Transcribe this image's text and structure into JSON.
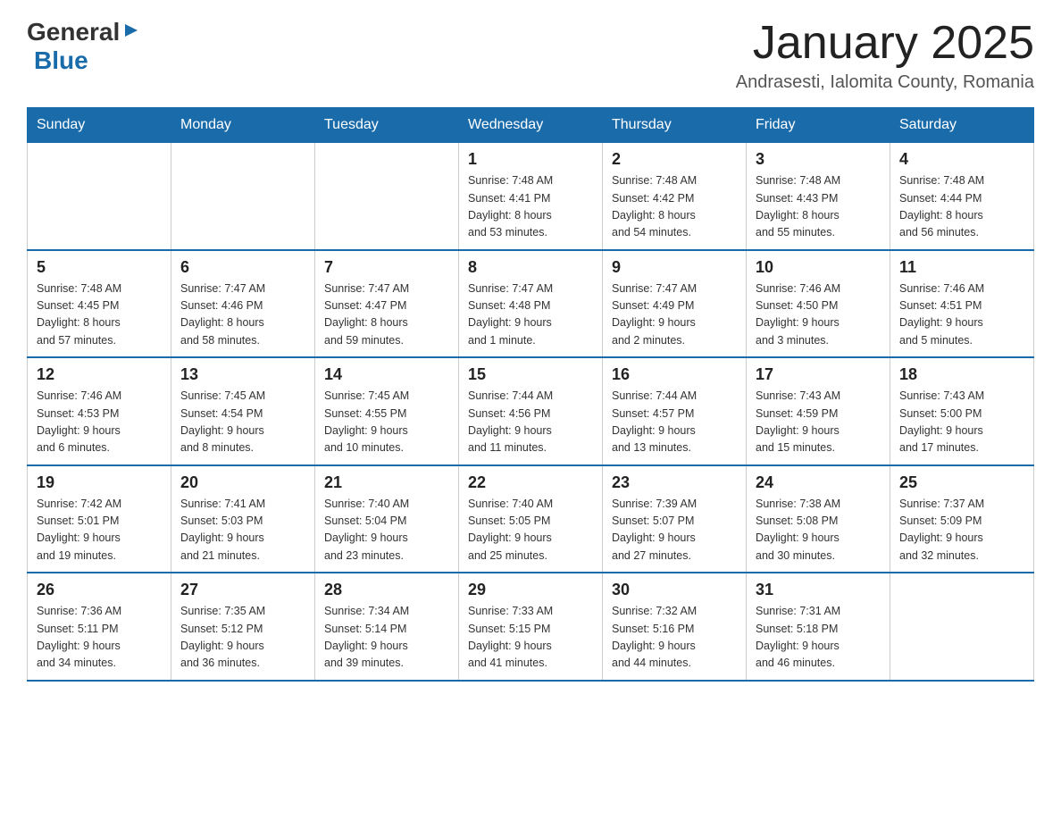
{
  "header": {
    "logo": {
      "general": "General",
      "blue": "Blue"
    },
    "title": "January 2025",
    "subtitle": "Andrasesti, Ialomita County, Romania"
  },
  "weekdays": [
    "Sunday",
    "Monday",
    "Tuesday",
    "Wednesday",
    "Thursday",
    "Friday",
    "Saturday"
  ],
  "weeks": [
    [
      {
        "day": "",
        "info": ""
      },
      {
        "day": "",
        "info": ""
      },
      {
        "day": "",
        "info": ""
      },
      {
        "day": "1",
        "info": "Sunrise: 7:48 AM\nSunset: 4:41 PM\nDaylight: 8 hours\nand 53 minutes."
      },
      {
        "day": "2",
        "info": "Sunrise: 7:48 AM\nSunset: 4:42 PM\nDaylight: 8 hours\nand 54 minutes."
      },
      {
        "day": "3",
        "info": "Sunrise: 7:48 AM\nSunset: 4:43 PM\nDaylight: 8 hours\nand 55 minutes."
      },
      {
        "day": "4",
        "info": "Sunrise: 7:48 AM\nSunset: 4:44 PM\nDaylight: 8 hours\nand 56 minutes."
      }
    ],
    [
      {
        "day": "5",
        "info": "Sunrise: 7:48 AM\nSunset: 4:45 PM\nDaylight: 8 hours\nand 57 minutes."
      },
      {
        "day": "6",
        "info": "Sunrise: 7:47 AM\nSunset: 4:46 PM\nDaylight: 8 hours\nand 58 minutes."
      },
      {
        "day": "7",
        "info": "Sunrise: 7:47 AM\nSunset: 4:47 PM\nDaylight: 8 hours\nand 59 minutes."
      },
      {
        "day": "8",
        "info": "Sunrise: 7:47 AM\nSunset: 4:48 PM\nDaylight: 9 hours\nand 1 minute."
      },
      {
        "day": "9",
        "info": "Sunrise: 7:47 AM\nSunset: 4:49 PM\nDaylight: 9 hours\nand 2 minutes."
      },
      {
        "day": "10",
        "info": "Sunrise: 7:46 AM\nSunset: 4:50 PM\nDaylight: 9 hours\nand 3 minutes."
      },
      {
        "day": "11",
        "info": "Sunrise: 7:46 AM\nSunset: 4:51 PM\nDaylight: 9 hours\nand 5 minutes."
      }
    ],
    [
      {
        "day": "12",
        "info": "Sunrise: 7:46 AM\nSunset: 4:53 PM\nDaylight: 9 hours\nand 6 minutes."
      },
      {
        "day": "13",
        "info": "Sunrise: 7:45 AM\nSunset: 4:54 PM\nDaylight: 9 hours\nand 8 minutes."
      },
      {
        "day": "14",
        "info": "Sunrise: 7:45 AM\nSunset: 4:55 PM\nDaylight: 9 hours\nand 10 minutes."
      },
      {
        "day": "15",
        "info": "Sunrise: 7:44 AM\nSunset: 4:56 PM\nDaylight: 9 hours\nand 11 minutes."
      },
      {
        "day": "16",
        "info": "Sunrise: 7:44 AM\nSunset: 4:57 PM\nDaylight: 9 hours\nand 13 minutes."
      },
      {
        "day": "17",
        "info": "Sunrise: 7:43 AM\nSunset: 4:59 PM\nDaylight: 9 hours\nand 15 minutes."
      },
      {
        "day": "18",
        "info": "Sunrise: 7:43 AM\nSunset: 5:00 PM\nDaylight: 9 hours\nand 17 minutes."
      }
    ],
    [
      {
        "day": "19",
        "info": "Sunrise: 7:42 AM\nSunset: 5:01 PM\nDaylight: 9 hours\nand 19 minutes."
      },
      {
        "day": "20",
        "info": "Sunrise: 7:41 AM\nSunset: 5:03 PM\nDaylight: 9 hours\nand 21 minutes."
      },
      {
        "day": "21",
        "info": "Sunrise: 7:40 AM\nSunset: 5:04 PM\nDaylight: 9 hours\nand 23 minutes."
      },
      {
        "day": "22",
        "info": "Sunrise: 7:40 AM\nSunset: 5:05 PM\nDaylight: 9 hours\nand 25 minutes."
      },
      {
        "day": "23",
        "info": "Sunrise: 7:39 AM\nSunset: 5:07 PM\nDaylight: 9 hours\nand 27 minutes."
      },
      {
        "day": "24",
        "info": "Sunrise: 7:38 AM\nSunset: 5:08 PM\nDaylight: 9 hours\nand 30 minutes."
      },
      {
        "day": "25",
        "info": "Sunrise: 7:37 AM\nSunset: 5:09 PM\nDaylight: 9 hours\nand 32 minutes."
      }
    ],
    [
      {
        "day": "26",
        "info": "Sunrise: 7:36 AM\nSunset: 5:11 PM\nDaylight: 9 hours\nand 34 minutes."
      },
      {
        "day": "27",
        "info": "Sunrise: 7:35 AM\nSunset: 5:12 PM\nDaylight: 9 hours\nand 36 minutes."
      },
      {
        "day": "28",
        "info": "Sunrise: 7:34 AM\nSunset: 5:14 PM\nDaylight: 9 hours\nand 39 minutes."
      },
      {
        "day": "29",
        "info": "Sunrise: 7:33 AM\nSunset: 5:15 PM\nDaylight: 9 hours\nand 41 minutes."
      },
      {
        "day": "30",
        "info": "Sunrise: 7:32 AM\nSunset: 5:16 PM\nDaylight: 9 hours\nand 44 minutes."
      },
      {
        "day": "31",
        "info": "Sunrise: 7:31 AM\nSunset: 5:18 PM\nDaylight: 9 hours\nand 46 minutes."
      },
      {
        "day": "",
        "info": ""
      }
    ]
  ]
}
